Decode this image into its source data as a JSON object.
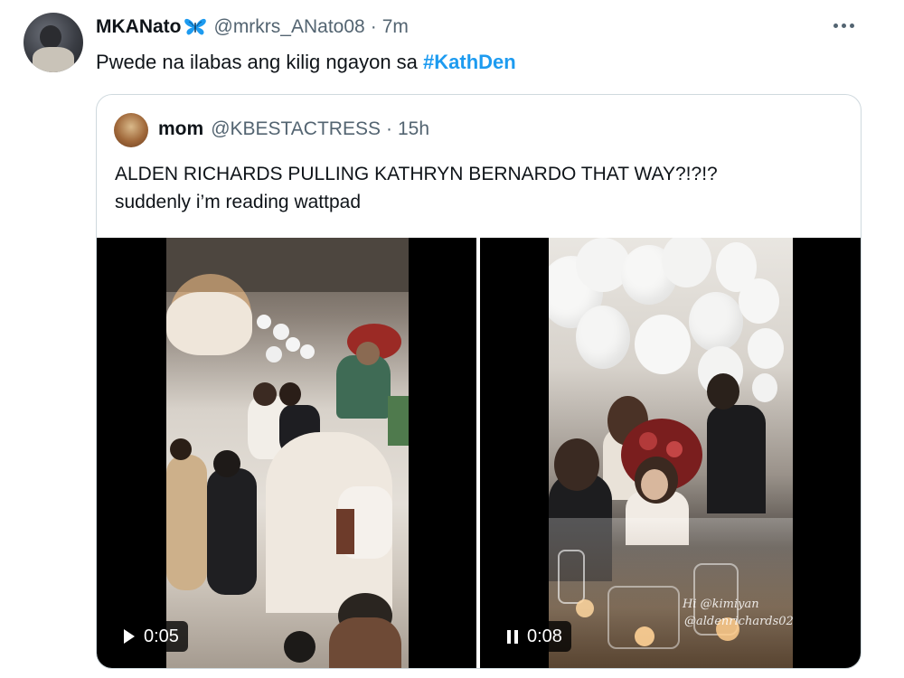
{
  "tweet": {
    "display_name": "MKANato",
    "handle": "@mrkrs_ANato08",
    "separator": "·",
    "time": "7m",
    "text_prefix": "Pwede na ilabas ang kilig ngayon sa ",
    "hashtag": "#KathDen",
    "badge_icon": "butterfly-emoji"
  },
  "quote": {
    "display_name": "mom",
    "handle": "@KBESTACTRESS",
    "separator": "·",
    "time": "15h",
    "line1": "ALDEN RICHARDS PULLING KATHRYN BERNARDO THAT WAY?!?!?",
    "line2": "suddenly i’m reading wattpad"
  },
  "media": [
    {
      "time": "0:05",
      "state": "paused",
      "icon": "play-icon"
    },
    {
      "time": "0:08",
      "state": "playing",
      "icon": "pause-icon",
      "overlay_lines": [
        "Hi @kimiyan",
        "@aldenrichards02"
      ]
    }
  ]
}
